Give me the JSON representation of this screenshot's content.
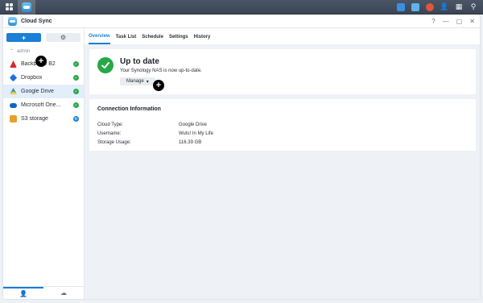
{
  "app": {
    "title": "Cloud Sync"
  },
  "sidebar": {
    "owner": "admin",
    "items": [
      {
        "label": "Backblaze B2",
        "icon": "backblaze-icon",
        "status": "up-to-date",
        "color": "#d9282f"
      },
      {
        "label": "Dropbox",
        "icon": "dropbox-icon",
        "status": "up-to-date",
        "color": "#1f6fe0"
      },
      {
        "label": "Google Drive",
        "icon": "google-drive-icon",
        "status": "up-to-date",
        "color": "#1fa463",
        "selected": true
      },
      {
        "label": "Microsoft One...",
        "icon": "onedrive-icon",
        "status": "up-to-date",
        "color": "#0a67c8"
      },
      {
        "label": "S3 storage",
        "icon": "s3-icon",
        "status": "syncing",
        "color": "#e8a02a"
      }
    ]
  },
  "tabs": [
    {
      "label": "Overview",
      "active": true
    },
    {
      "label": "Task List"
    },
    {
      "label": "Schedule"
    },
    {
      "label": "Settings"
    },
    {
      "label": "History"
    }
  ],
  "status": {
    "title": "Up to date",
    "description": "Your Synology NAS is now up-to-date.",
    "manage_label": "Manage"
  },
  "connection_info": {
    "title": "Connection Information",
    "rows": [
      {
        "key": "Cloud Type:",
        "value": "Google Drive"
      },
      {
        "key": "Username:",
        "value": "Wuts! In My Life"
      },
      {
        "key": "Storage Usage:",
        "value": "116.39 GB"
      }
    ]
  },
  "colors": {
    "accent": "#1a7fd6",
    "success": "#27a847",
    "taskbar": "#424d5d"
  }
}
